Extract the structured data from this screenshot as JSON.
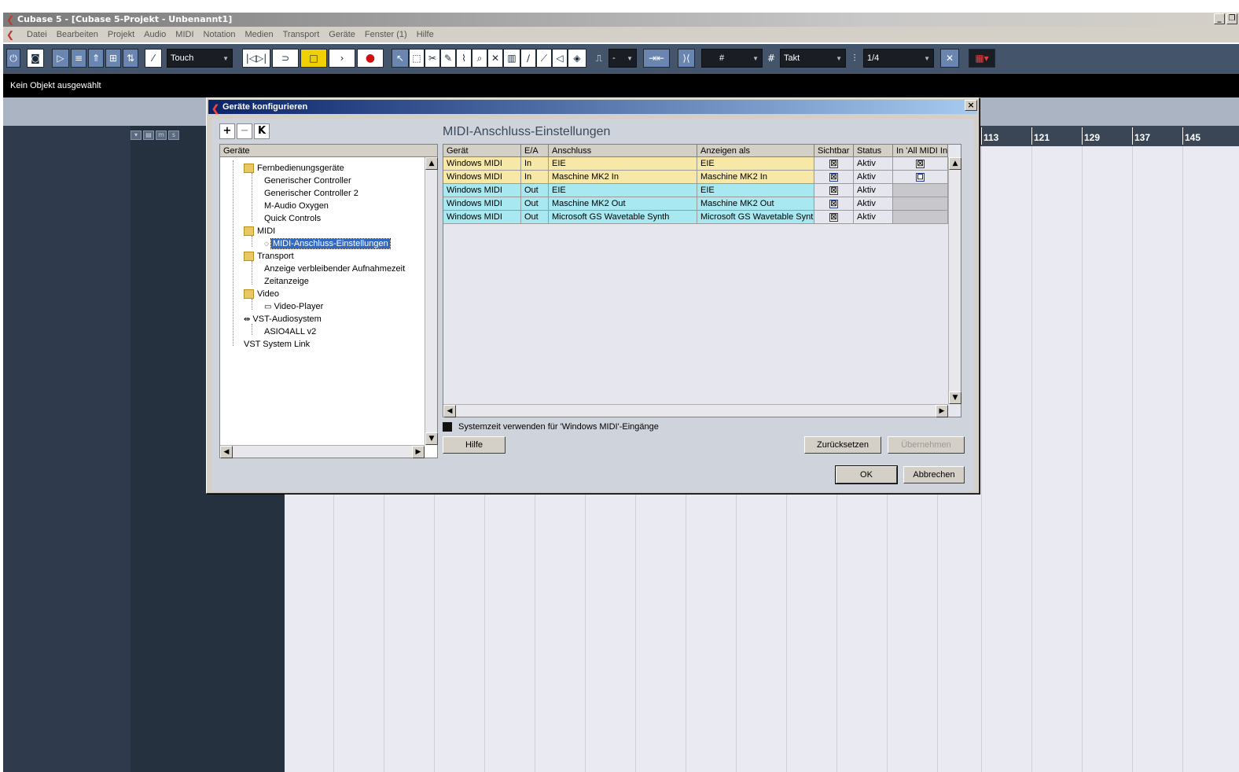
{
  "app": {
    "title": "Cubase 5 - [Cubase 5-Projekt - Unbenannt1]",
    "window_controls": [
      "_",
      "❐"
    ]
  },
  "menu": [
    "Datei",
    "Bearbeiten",
    "Projekt",
    "Audio",
    "MIDI",
    "Notation",
    "Medien",
    "Transport",
    "Geräte",
    "Fenster (1)",
    "Hilfe"
  ],
  "toolbar": {
    "automation_mode": "Touch",
    "grid_type": "Takt",
    "quantize": "1/4",
    "nudge_value": "-"
  },
  "infoline": {
    "text": "Kein Objekt ausgewählt"
  },
  "ruler": {
    "bars": [
      "113",
      "121",
      "129",
      "137",
      "145"
    ]
  },
  "dialog": {
    "title": "Geräte konfigurieren",
    "close": "×",
    "panel_title": "MIDI-Anschluss-Einstellungen",
    "tree_tools": [
      "+",
      "−",
      "K"
    ],
    "tree_header": "Geräte",
    "tree": [
      {
        "label": "Fernbedienungsgeräte",
        "type": "folder"
      },
      {
        "label": "Generischer Controller",
        "type": "leaf"
      },
      {
        "label": "Generischer Controller 2",
        "type": "leaf"
      },
      {
        "label": "M-Audio Oxygen",
        "type": "leaf"
      },
      {
        "label": "Quick Controls",
        "type": "leaf"
      },
      {
        "label": "MIDI",
        "type": "folder"
      },
      {
        "label": "MIDI-Anschluss-Einstellungen",
        "type": "selected"
      },
      {
        "label": "Transport",
        "type": "folder"
      },
      {
        "label": "Anzeige verbleibender Aufnahmezeit",
        "type": "leaf"
      },
      {
        "label": "Zeitanzeige",
        "type": "leaf"
      },
      {
        "label": "Video",
        "type": "folder"
      },
      {
        "label": "Video-Player",
        "type": "leaf"
      },
      {
        "label": "VST-Audiosystem",
        "type": "folder"
      },
      {
        "label": "ASIO4ALL v2",
        "type": "leaf"
      },
      {
        "label": "VST System Link",
        "type": "root"
      }
    ],
    "columns": [
      "Gerät",
      "E/A",
      "Anschluss",
      "Anzeigen als",
      "Sichtbar",
      "Status",
      "In 'All MIDI In'"
    ],
    "rows": [
      {
        "geraet": "Windows MIDI",
        "ea": "In",
        "anschluss": "EIE",
        "anzeigen": "EIE",
        "sichtbar": "☒",
        "status": "Aktiv",
        "allmidi": "☒",
        "color": "#f8e8a8"
      },
      {
        "geraet": "Windows MIDI",
        "ea": "In",
        "anschluss": "Maschine MK2 In",
        "anzeigen": "Maschine MK2 In",
        "sichtbar": "☒",
        "status": "Aktiv",
        "allmidi": "☐",
        "color": "#f8e8a8"
      },
      {
        "geraet": "Windows MIDI",
        "ea": "Out",
        "anschluss": "EIE",
        "anzeigen": "EIE",
        "sichtbar": "☒",
        "status": "Aktiv",
        "allmidi": "",
        "color": "#a8e8f0"
      },
      {
        "geraet": "Windows MIDI",
        "ea": "Out",
        "anschluss": "Maschine MK2 Out",
        "anzeigen": "Maschine MK2 Out",
        "sichtbar": "☒",
        "status": "Aktiv",
        "allmidi": "",
        "color": "#a8e8f0"
      },
      {
        "geraet": "Windows MIDI",
        "ea": "Out",
        "anschluss": "Microsoft GS Wavetable Synth",
        "anzeigen": "Microsoft GS Wavetable Synth",
        "sichtbar": "☒",
        "status": "Aktiv",
        "allmidi": "",
        "color": "#a8e8f0"
      }
    ],
    "systime_label": "Systemzeit verwenden für 'Windows MIDI'-Eingänge",
    "buttons": {
      "help": "Hilfe",
      "reset": "Zurücksetzen",
      "apply": "Übernehmen",
      "ok": "OK",
      "cancel": "Abbrechen"
    }
  }
}
